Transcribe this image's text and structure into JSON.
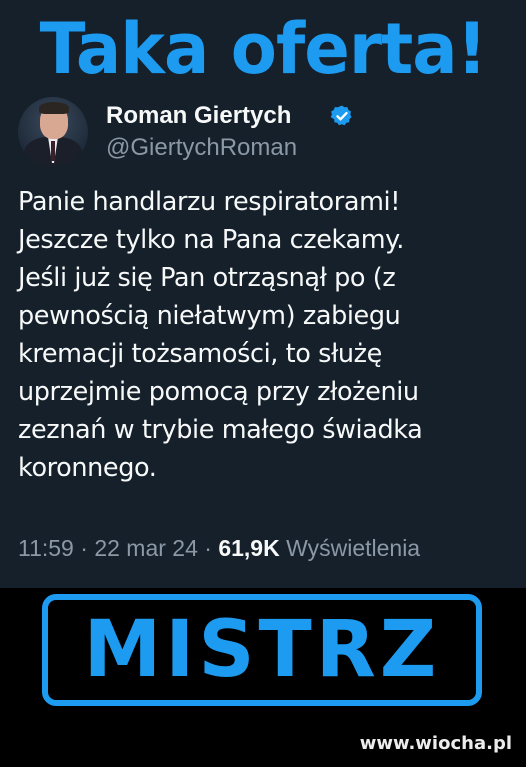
{
  "headline": "Taka oferta!",
  "tweet": {
    "display_name": "Roman Giertych",
    "handle": "@GiertychRoman",
    "verified_icon": "verified-badge-icon",
    "text_lines": [
      "Panie handlarzu respiratorami!",
      "Jeszcze tylko na Pana czekamy.",
      "Jeśli już się Pan otrząsnął po (z",
      "pewnością niełatwym) zabiegu",
      "kremacji tożsamości, to służę",
      "uprzejmie pomocą przy złożeniu",
      "zeznań w trybie małego świadka",
      "koronnego."
    ],
    "time": "11:59",
    "separator": " · ",
    "date": "22 mar 24",
    "views_count": "61,9K",
    "views_label": " Wyświetlenia"
  },
  "badge": {
    "label": "MISTRZ"
  },
  "watermark": "www.wiocha.pl",
  "colors": {
    "accent": "#1d9bf0",
    "tweet_background": "#15202b",
    "page_background": "#000000",
    "primary_text": "#f7f9f9",
    "secondary_text": "#8b98a5"
  }
}
